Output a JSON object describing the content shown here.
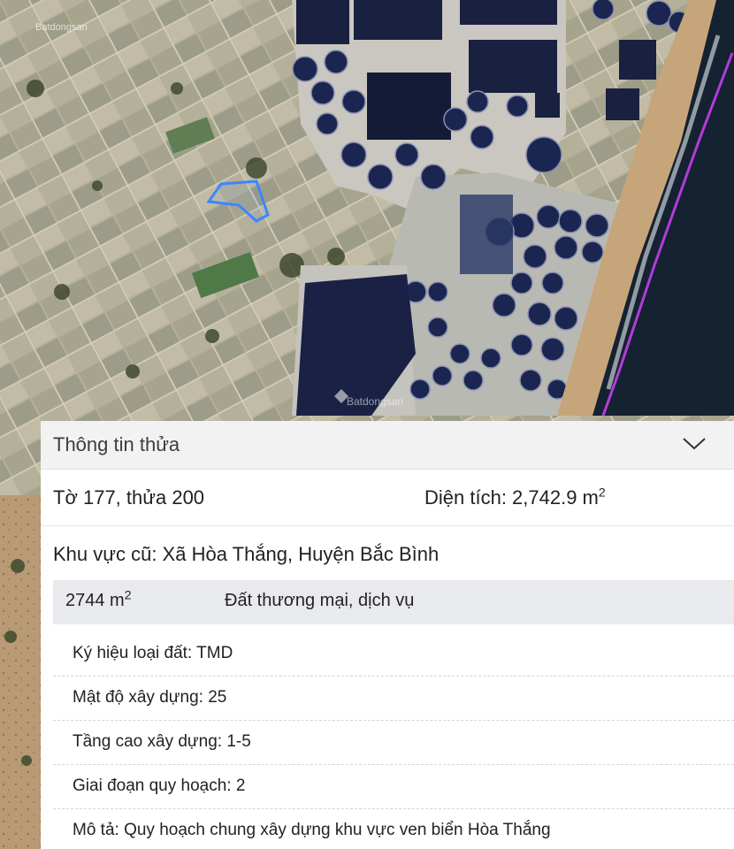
{
  "map": {
    "watermark_text": "Batdongsan",
    "colors": {
      "parcel_outline": "#3d86ff",
      "coast_line": "#b23cd9",
      "sea": "#142231",
      "ponds": "#1a2040"
    }
  },
  "panel": {
    "title": "Thông tin thửa",
    "collapse_icon": "chevron-down-icon",
    "sheet_parcel": "Tờ 177, thửa 200",
    "area_label": "Diện tích: 2,742.9 m",
    "area_sup": "2",
    "old_region": "Khu vực cũ: Xã Hòa Thắng, Huyện Bắc Bình",
    "zone": {
      "area": "2744 m",
      "area_sup": "2",
      "land_use": "Đất thương mại, dịch vụ"
    },
    "details": [
      {
        "text": "Ký hiệu loại đất: TMD"
      },
      {
        "text": "Mật độ xây dựng: 25"
      },
      {
        "text": "Tầng cao xây dựng: 1-5"
      },
      {
        "text": "Giai đoạn quy hoạch: 2"
      },
      {
        "text": "Mô tả: Quy hoạch chung xây dựng khu vực ven biển Hòa Thắng"
      }
    ]
  }
}
